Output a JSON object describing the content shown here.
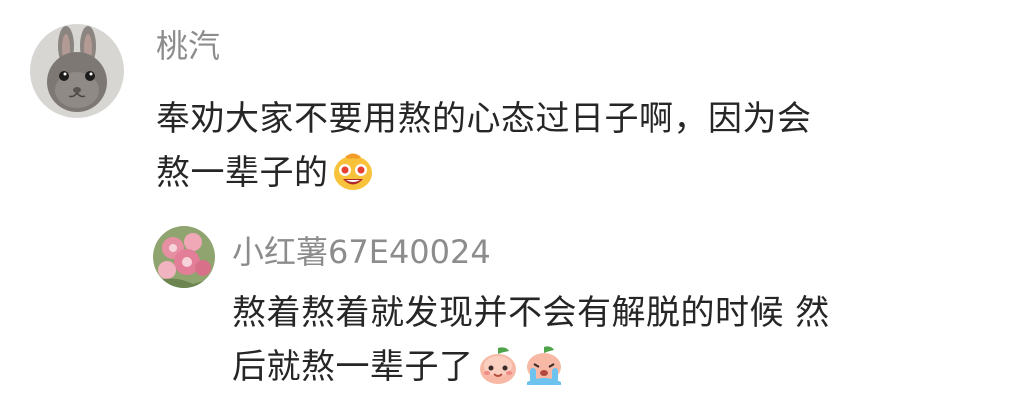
{
  "comments": [
    {
      "username": "桃汽",
      "avatar_icon": "bunny-avatar",
      "lines": [
        "奉劝大家不要用熬的心态过日子啊，因为会",
        "熬一辈子的"
      ],
      "emojis": [
        "grinning-face-emoji"
      ]
    },
    {
      "username": "小红薯67E40024",
      "avatar_icon": "flower-avatar",
      "lines": [
        "熬着熬着就发现并不会有解脱的时候 然",
        "后就熬一辈子了"
      ],
      "emojis": [
        "peach-face-emoji",
        "crying-face-emoji"
      ]
    }
  ]
}
